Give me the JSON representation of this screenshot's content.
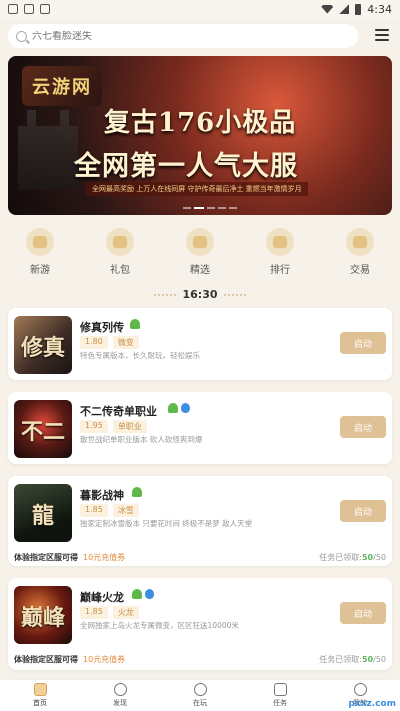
{
  "status_bar": {
    "time": "4:34"
  },
  "search": {
    "placeholder": "六七看脸迷失"
  },
  "banner": {
    "logo_text": "云游网",
    "headline_1": "复古176小极品",
    "headline_2": "全网第一人气大服",
    "tagline": "全网最高奖励  上万人在线同屏  守护传奇最后净土  重燃当年激情岁月"
  },
  "categories": [
    {
      "label": "新游",
      "icon": "gamepad-icon"
    },
    {
      "label": "礼包",
      "icon": "gift-icon"
    },
    {
      "label": "精选",
      "icon": "heart-icon"
    },
    {
      "label": "排行",
      "icon": "ranking-icon"
    },
    {
      "label": "交易",
      "icon": "trade-icon"
    }
  ],
  "time_label": "16:30",
  "games": [
    {
      "name": "修真列传",
      "version": "1.80",
      "type": "微变",
      "desc": "特色专属版本，长久耐玩，轻松娱乐",
      "button": "启动",
      "thumb_text": "修真",
      "platforms": [
        "android"
      ]
    },
    {
      "name": "不二传奇单职业",
      "version": "1.95",
      "type": "单职业",
      "desc": "散世战纪单职业版本 砍人砍怪爽到爆",
      "button": "启动",
      "thumb_text": "不二",
      "platforms": [
        "android",
        "apple"
      ]
    },
    {
      "name": "暮影战神",
      "version": "1.85",
      "type": "冰雪",
      "desc": "独家定制冰雪版本 只要花时间 终极不是梦 敌人天堂",
      "button": "启动",
      "thumb_text": "龍",
      "platforms": [
        "android"
      ],
      "footer": {
        "label": "体验指定区服可得",
        "reward": "10元充值券",
        "progress_label": "任务已领取:",
        "progress_done": "50",
        "progress_total": "/50"
      }
    },
    {
      "name": "巅峰火龙",
      "version": "1.85",
      "type": "火龙",
      "desc": "全网独家上岛火龙专属微变，区区狂送10000米",
      "button": "启动",
      "thumb_text": "巅峰",
      "platforms": [
        "android",
        "apple"
      ],
      "footer": {
        "label": "体验指定区服可得",
        "reward": "10元充值券",
        "progress_label": "任务已领取:",
        "progress_done": "50",
        "progress_total": "/50"
      }
    }
  ],
  "tabs": [
    {
      "label": "首页",
      "icon": "home-icon"
    },
    {
      "label": "发现",
      "icon": "compass-icon"
    },
    {
      "label": "在玩",
      "icon": "play-icon"
    },
    {
      "label": "任务",
      "icon": "task-icon"
    },
    {
      "label": "我的",
      "icon": "user-icon"
    }
  ],
  "watermark": "pxxz.com"
}
